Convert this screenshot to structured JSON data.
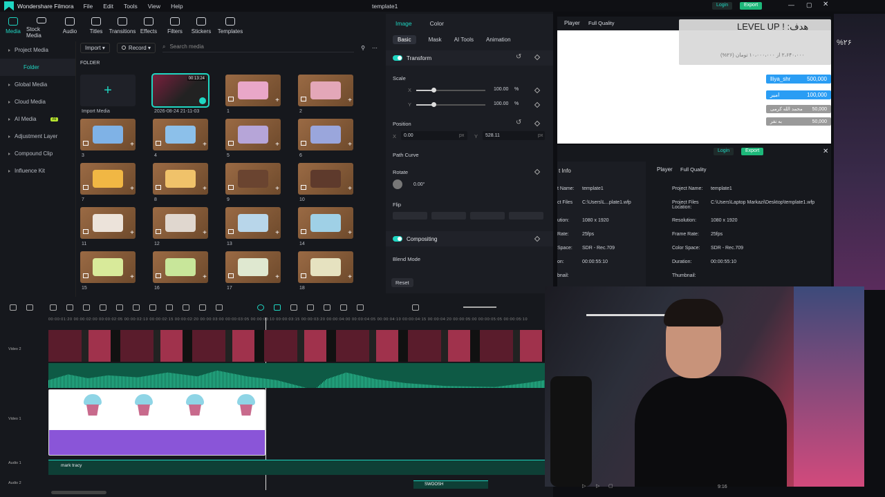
{
  "titlebar": {
    "app_name": "Wondershare Filmora",
    "menu": [
      "File",
      "Edit",
      "Tools",
      "View",
      "Help"
    ],
    "project_title": "template1"
  },
  "toolbar": {
    "items": [
      "Media",
      "Stock Media",
      "Audio",
      "Titles",
      "Transitions",
      "Effects",
      "Filters",
      "Stickers",
      "Templates"
    ]
  },
  "sidebar": {
    "items": [
      {
        "label": "Project Media"
      },
      {
        "label": "Folder"
      },
      {
        "label": "Global Media"
      },
      {
        "label": "Cloud Media"
      },
      {
        "label": "AI Media",
        "badge": "AI"
      },
      {
        "label": "Adjustment Layer"
      },
      {
        "label": "Compound Clip"
      },
      {
        "label": "Influence Kit"
      }
    ]
  },
  "media": {
    "import_label": "Import",
    "record_label": "Record",
    "search_placeholder": "Search media",
    "folder_label": "FOLDER",
    "import_media_label": "Import Media",
    "items": [
      {
        "label": "2026-08-24 21-11-03",
        "duration": "00:13:24"
      },
      {
        "label": "1"
      },
      {
        "label": "2"
      },
      {
        "label": "3"
      },
      {
        "label": "4"
      },
      {
        "label": "5"
      },
      {
        "label": "6"
      },
      {
        "label": "7"
      },
      {
        "label": "8"
      },
      {
        "label": "9"
      },
      {
        "label": "10"
      },
      {
        "label": "11"
      },
      {
        "label": "12"
      },
      {
        "label": "13"
      },
      {
        "label": "14"
      },
      {
        "label": "15"
      },
      {
        "label": "16"
      },
      {
        "label": "17"
      },
      {
        "label": "18"
      }
    ]
  },
  "props": {
    "tabs": [
      "Image",
      "Color"
    ],
    "subtabs": [
      "Basic",
      "Mask",
      "AI Tools",
      "Animation"
    ],
    "transform_label": "Transform",
    "scale_label": "Scale",
    "scale_x": "100.00",
    "scale_y": "100.00",
    "pct": "%",
    "x_label": "X",
    "y_label": "Y",
    "position_label": "Position",
    "pos_x": "0.00",
    "pos_y": "528.11",
    "px": "px",
    "path_curve_label": "Path Curve",
    "rotate_label": "Rotate",
    "rotate_value": "0.00°",
    "flip_label": "Flip",
    "compositing_label": "Compositing",
    "blend_mode_label": "Blend Mode",
    "reset_label": "Reset"
  },
  "timeline": {
    "ruler": "00:00:01:20  00:00:02:00  00:00:02:05  00:00:02:10  00:00:02:15  00:00:02:20  00:00:03:00  00:00:03:05  00:00:03:10  00:00:03:15  00:00:03:20  00:00:04:00  00:00:04:05  00:00:04:10  00:00:04:15  00:00:04:20  00:00:05:00  00:00:05:05  00:00:05:10",
    "track_video2": "Video 2",
    "track_video1": "Video 1",
    "track_audio1": "Audio 1",
    "track_audio2": "Audio 2",
    "audio_clip": "mark tracy",
    "swoosh_clip": "SWOOSH"
  },
  "right": {
    "login": "Login",
    "export": "Export",
    "player_label": "Player",
    "quality": "Full Quality",
    "donation": {
      "title": "هدف: ! LEVEL UP",
      "percent": "%۲۶",
      "subtitle": "۲،۶۴۰،۰۰۰ از ۱۰،۰۰۰،۰۰۰ تومان (۲۶%)",
      "donors": [
        {
          "name": "lliya_shr",
          "amount": "500,000",
          "color": "#2a9df4"
        },
        {
          "name": "امیر",
          "amount": "100,000",
          "color": "#2a9df4"
        },
        {
          "name": "محمد الله کرمی",
          "amount": "50,000",
          "color": "#9a9a9a"
        },
        {
          "name": "به نفر",
          "amount": "50,000",
          "color": "#9a9a9a"
        }
      ]
    },
    "info_tab": "t Info",
    "info_left": [
      {
        "k": "t Name:",
        "v": "template1"
      },
      {
        "k": "ct Files",
        "v": "C:\\Users\\L...plate1.wfp"
      },
      {
        "k": "ution:",
        "v": "1080 x 1920"
      },
      {
        "k": "Rate:",
        "v": "25fps"
      },
      {
        "k": "Space:",
        "v": "SDR - Rec.709"
      },
      {
        "k": "on:",
        "v": "00:00:55:10"
      },
      {
        "k": "bnail:",
        "v": ""
      }
    ],
    "info_right": [
      {
        "k": "Project Name:",
        "v": "template1"
      },
      {
        "k": "Project Files Location:",
        "v": "C:\\Users\\Laptop Markazi\\Desktop\\template1.wfp"
      },
      {
        "k": "Resolution:",
        "v": "1080 x 1920"
      },
      {
        "k": "Frame Rate:",
        "v": "25fps"
      },
      {
        "k": "Color Space:",
        "v": "SDR - Rec.709"
      },
      {
        "k": "Duration:",
        "v": "00:00:55:10"
      },
      {
        "k": "Thumbnail:",
        "v": ""
      }
    ],
    "aspect": "9:16"
  },
  "colors": {
    "accent": "#1fd6c2",
    "export": "#1db87a",
    "login": "#1fd6c2"
  }
}
